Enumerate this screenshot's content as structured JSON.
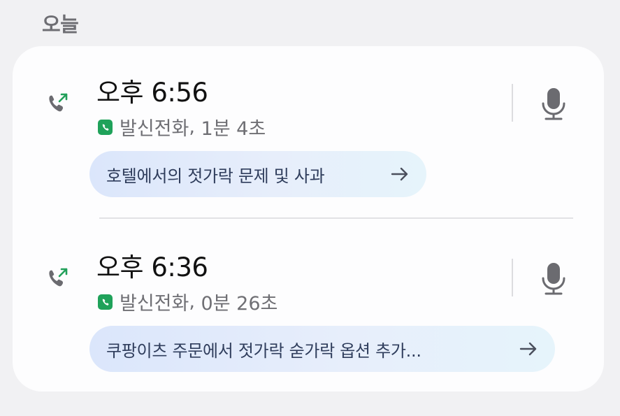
{
  "section": {
    "title": "오늘"
  },
  "calls": [
    {
      "time": "오후 6:56",
      "type": "발신전화",
      "duration": "1분 4초",
      "summary": "호텔에서의 젓가락 문제 및 사과",
      "icons": {
        "call": "outgoing-call-icon",
        "badge": "phone-app-icon",
        "record": "microphone-icon",
        "summary_arrow": "arrow-right-icon"
      }
    },
    {
      "time": "오후 6:36",
      "type": "발신전화",
      "duration": "0분 26초",
      "summary": "쿠팡이츠 주문에서 젓가락 숟가락 옵션 추가...",
      "icons": {
        "call": "outgoing-call-icon",
        "badge": "phone-app-icon",
        "record": "microphone-icon",
        "summary_arrow": "arrow-right-icon"
      }
    }
  ],
  "colors": {
    "accent_green": "#1fa25a",
    "outgoing_arrow": "#22a05a",
    "summary_text": "#2f3d5c"
  }
}
